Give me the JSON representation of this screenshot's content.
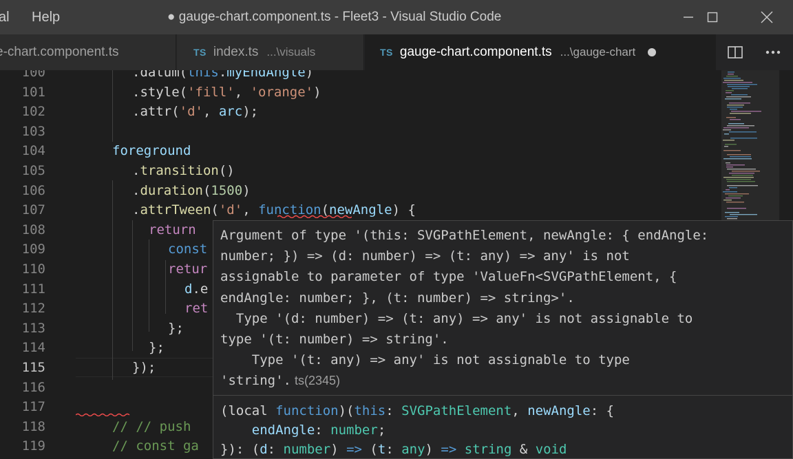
{
  "window": {
    "title": "● gauge-chart.component.ts - Fleet3 - Visual Studio Code",
    "menu": [
      "al",
      "Help"
    ]
  },
  "tabs": [
    {
      "name": "e-chart.component.ts",
      "path": "",
      "active": false
    },
    {
      "badge": "TS",
      "name": "index.ts",
      "path": "...\\visuals",
      "active": false
    },
    {
      "badge": "TS",
      "name": "gauge-chart.component.ts",
      "path": "...\\gauge-chart",
      "active": true,
      "dirty": true
    }
  ],
  "editor": {
    "current_line": 115,
    "line_numbers": [
      "100",
      "101",
      "102",
      "103",
      "104",
      "105",
      "106",
      "107",
      "108",
      "109",
      "110",
      "111",
      "112",
      "113",
      "114",
      "115",
      "116",
      "117",
      "118",
      "119"
    ],
    "lines": [
      [
        [
          ".datum(",
          "p"
        ],
        [
          "this",
          "k"
        ],
        [
          ".",
          "p"
        ],
        [
          "myEndAngle",
          "v"
        ],
        [
          ")",
          "p"
        ]
      ],
      [
        [
          ".style(",
          "p"
        ],
        [
          "'fill'",
          "s"
        ],
        [
          ", ",
          "p"
        ],
        [
          "'orange'",
          "s"
        ],
        [
          ")",
          "p"
        ]
      ],
      [
        [
          ".attr(",
          "p"
        ],
        [
          "'d'",
          "s"
        ],
        [
          ", ",
          "p"
        ],
        [
          "arc",
          "v"
        ],
        [
          ");",
          "p"
        ]
      ],
      [],
      [
        [
          "foreground",
          "v"
        ]
      ],
      [
        [
          ".",
          "p"
        ],
        [
          "transition",
          "f"
        ],
        [
          "()",
          "p"
        ]
      ],
      [
        [
          ".",
          "p"
        ],
        [
          "duration",
          "f"
        ],
        [
          "(",
          "p"
        ],
        [
          "1500",
          "n"
        ],
        [
          ")",
          "p"
        ]
      ],
      [
        [
          ".",
          "p"
        ],
        [
          "attrTween",
          "f"
        ],
        [
          "(",
          "p"
        ],
        [
          "'d'",
          "s"
        ],
        [
          ", ",
          "p"
        ],
        [
          "function",
          "k"
        ],
        [
          "(",
          "p"
        ],
        [
          "newAngle",
          "v"
        ],
        [
          ") {",
          "p"
        ]
      ],
      [
        [
          "return",
          "kc"
        ]
      ],
      [
        [
          "const",
          "k"
        ]
      ],
      [
        [
          "retur",
          "kc"
        ]
      ],
      [
        [
          "d",
          "v"
        ],
        [
          ".e",
          "p"
        ]
      ],
      [
        [
          "ret",
          "kc"
        ]
      ],
      [
        [
          "};",
          "p"
        ]
      ],
      [
        [
          "};",
          "p"
        ]
      ],
      [
        [
          "});",
          "p"
        ]
      ],
      [],
      [],
      [
        [
          "// // push",
          "c"
        ]
      ],
      [
        [
          "// const ga",
          "c"
        ]
      ]
    ]
  },
  "hover": {
    "diagnostic": [
      "Argument of type '(this: SVGPathElement, newAngle: { endAngle:",
      "number; }) => (d: number) => (t: any) => any' is not",
      "assignable to parameter of type 'ValueFn<SVGPathElement, {",
      "endAngle: number; }, (t: number) => string>'.",
      "  Type '(d: number) => (t: any) => any' is not assignable to",
      "type '(t: number) => string'.",
      "    Type '(t: any) => any' is not assignable to type",
      "'string'."
    ],
    "error_code": "ts(2345)",
    "signature": [
      [
        [
          "(local ",
          "p"
        ],
        [
          "function",
          "k"
        ],
        [
          ")(",
          "p"
        ],
        [
          "this",
          "k"
        ],
        [
          ": ",
          "p"
        ],
        [
          "SVGPathElement",
          "t"
        ],
        [
          ", ",
          "p"
        ],
        [
          "newAngle",
          "v"
        ],
        [
          ": {",
          "p"
        ]
      ],
      [
        [
          "    ",
          "p"
        ],
        [
          "endAngle",
          "v"
        ],
        [
          ": ",
          "p"
        ],
        [
          "number",
          "t"
        ],
        [
          ";",
          "p"
        ]
      ],
      [
        [
          "}): (",
          "p"
        ],
        [
          "d",
          "v"
        ],
        [
          ": ",
          "p"
        ],
        [
          "number",
          "t"
        ],
        [
          ") ",
          "p"
        ],
        [
          "=>",
          "k"
        ],
        [
          " (",
          "p"
        ],
        [
          "t",
          "v"
        ],
        [
          ": ",
          "p"
        ],
        [
          "any",
          "t"
        ],
        [
          ") ",
          "p"
        ],
        [
          "=>",
          "k"
        ],
        [
          " ",
          "p"
        ],
        [
          "string",
          "t"
        ],
        [
          " & ",
          "p"
        ],
        [
          "void",
          "t"
        ]
      ]
    ]
  },
  "colors": {
    "keyword": "#569cd6",
    "control": "#c586c0",
    "function": "#dcdcaa",
    "string": "#ce9178",
    "number": "#b5cea8",
    "variable": "#9cdcfe",
    "type": "#4ec9b0",
    "comment": "#6a9955",
    "error": "#f14c4c",
    "ts_badge": "#519aba"
  },
  "icons": [
    "close-icon",
    "maximize-icon",
    "minimize-icon",
    "split-editor-icon",
    "more-actions-icon",
    "dirty-dot-icon"
  ]
}
